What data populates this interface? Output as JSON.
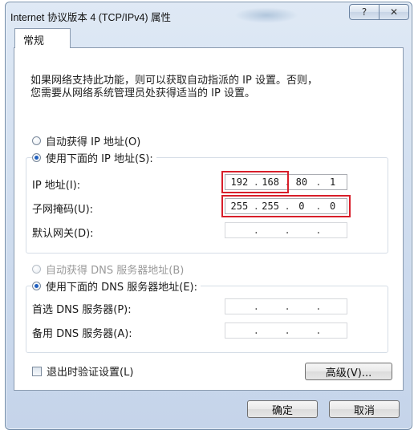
{
  "window": {
    "title": "Internet 协议版本 4 (TCP/IPv4) 属性",
    "help_label": "?",
    "close_label": "✕"
  },
  "tabs": [
    {
      "label": "常规"
    }
  ],
  "description": {
    "line1": "如果网络支持此功能，则可以获取自动指派的 IP 设置。否则，",
    "line2": "您需要从网络系统管理员处获得适当的 IP 设置。"
  },
  "ip_section": {
    "auto_option": "自动获得 IP 地址(O)",
    "manual_option": "使用下面的 IP 地址(S):",
    "selected": "manual",
    "fields": [
      {
        "label": "IP 地址(I):",
        "octets": [
          "192",
          "168",
          "80",
          "1"
        ]
      },
      {
        "label": "子网掩码(U):",
        "octets": [
          "255",
          "255",
          "0",
          "0"
        ]
      },
      {
        "label": "默认网关(D):",
        "octets": [
          "",
          "",
          "",
          ""
        ]
      }
    ]
  },
  "dns_section": {
    "auto_option": "自动获得 DNS 服务器地址(B)",
    "manual_option": "使用下面的 DNS 服务器地址(E):",
    "selected": "manual",
    "fields": [
      {
        "label": "首选 DNS 服务器(P):",
        "octets": [
          "",
          "",
          "",
          ""
        ]
      },
      {
        "label": "备用 DNS 服务器(A):",
        "octets": [
          "",
          "",
          "",
          ""
        ]
      }
    ]
  },
  "validate_on_exit": {
    "label": "退出时验证设置(L)",
    "checked": false
  },
  "buttons": {
    "advanced": "高级(V)...",
    "ok": "确定",
    "cancel": "取消"
  },
  "colors": {
    "highlight": "#d81e2a",
    "radio_selected": "#1f5fbf"
  }
}
